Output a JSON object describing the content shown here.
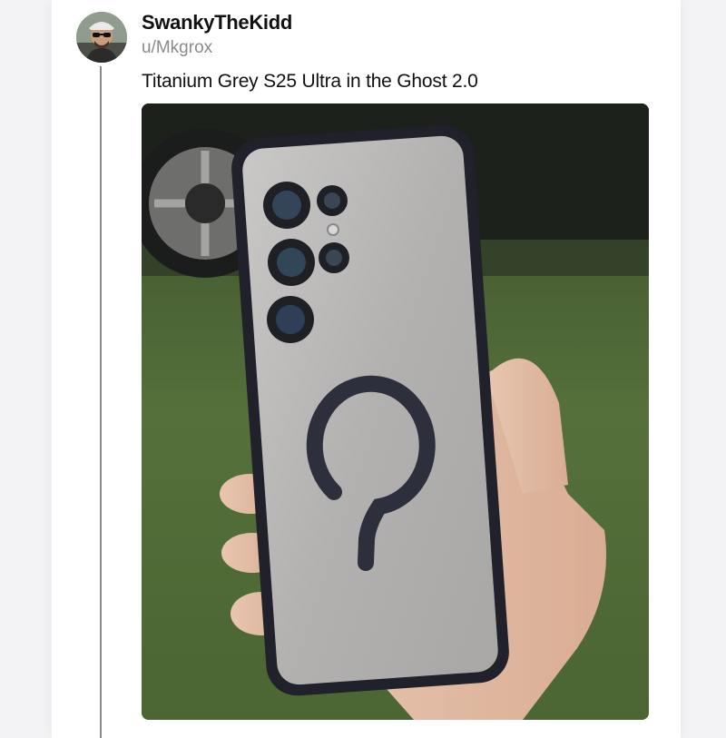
{
  "post": {
    "display_name": "SwankyTheKidd",
    "username": "u/Mkgrox",
    "text": "Titanium Grey S25 Ultra in the Ghost 2.0"
  },
  "image": {
    "subject": "phone-photo",
    "alt": ""
  },
  "colors": {
    "background": "#f3f3f6",
    "card": "#ffffff",
    "thread_line": "#8a8a8a",
    "name": "#111111",
    "username": "#8a8a8a"
  }
}
